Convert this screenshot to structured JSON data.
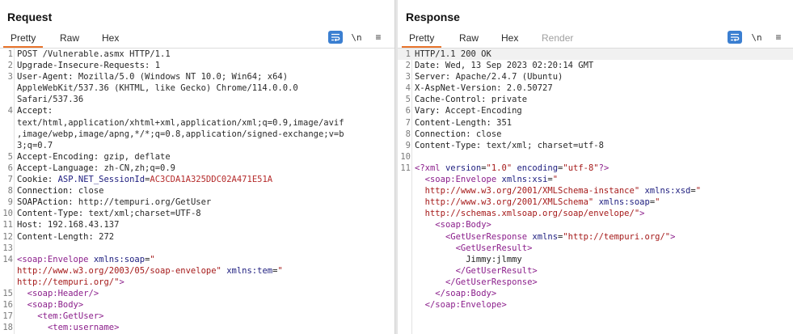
{
  "request": {
    "title": "Request",
    "tabs": [
      "Pretty",
      "Raw",
      "Hex"
    ],
    "active_tab": "Pretty",
    "lines": [
      {
        "n": "1",
        "parts": [
          {
            "c": "hv",
            "t": "POST /Vulnerable.asmx HTTP/1.1"
          }
        ]
      },
      {
        "n": "2",
        "parts": [
          {
            "c": "hn",
            "t": "Upgrade-Insecure-Requests:"
          },
          {
            "c": "hv",
            "t": " 1"
          }
        ]
      },
      {
        "n": "3",
        "parts": [
          {
            "c": "hn",
            "t": "User-Agent:"
          },
          {
            "c": "hv",
            "t": " Mozilla/5.0 (Windows NT 10.0; Win64; x64)"
          }
        ]
      },
      {
        "n": "",
        "parts": [
          {
            "c": "hv",
            "t": "AppleWebKit/537.36 (KHTML, like Gecko) Chrome/114.0.0.0"
          }
        ]
      },
      {
        "n": "",
        "parts": [
          {
            "c": "hv",
            "t": "Safari/537.36"
          }
        ]
      },
      {
        "n": "4",
        "parts": [
          {
            "c": "hn",
            "t": "Accept:"
          }
        ]
      },
      {
        "n": "",
        "parts": [
          {
            "c": "hv",
            "t": "text/html,application/xhtml+xml,application/xml;q=0.9,image/avif"
          }
        ]
      },
      {
        "n": "",
        "parts": [
          {
            "c": "hv",
            "t": ",image/webp,image/apng,*/*;q=0.8,application/signed-exchange;v=b"
          }
        ]
      },
      {
        "n": "",
        "parts": [
          {
            "c": "hv",
            "t": "3;q=0.7"
          }
        ]
      },
      {
        "n": "5",
        "parts": [
          {
            "c": "hn",
            "t": "Accept-Encoding:"
          },
          {
            "c": "hv",
            "t": " gzip, deflate"
          }
        ]
      },
      {
        "n": "6",
        "parts": [
          {
            "c": "hn",
            "t": "Accept-Language:"
          },
          {
            "c": "hv",
            "t": " zh-CN,zh;q=0.9"
          }
        ]
      },
      {
        "n": "7",
        "parts": [
          {
            "c": "hn",
            "t": "Cookie:"
          },
          {
            "c": "hv",
            "t": " "
          },
          {
            "c": "at",
            "t": "ASP.NET_SessionId"
          },
          {
            "c": "hv",
            "t": "="
          },
          {
            "c": "cv",
            "t": "AC3CDA1A325DDC02A471E51A"
          }
        ]
      },
      {
        "n": "8",
        "parts": [
          {
            "c": "hn",
            "t": "Connection:"
          },
          {
            "c": "hv",
            "t": " close"
          }
        ]
      },
      {
        "n": "9",
        "parts": [
          {
            "c": "hn",
            "t": "SOAPAction:"
          },
          {
            "c": "hv",
            "t": " http://tempuri.org/GetUser"
          }
        ]
      },
      {
        "n": "10",
        "parts": [
          {
            "c": "hn",
            "t": "Content-Type:"
          },
          {
            "c": "hv",
            "t": " text/xml;charset=UTF-8"
          }
        ]
      },
      {
        "n": "11",
        "parts": [
          {
            "c": "hn",
            "t": "Host:"
          },
          {
            "c": "hv",
            "t": " 192.168.43.137"
          }
        ]
      },
      {
        "n": "12",
        "parts": [
          {
            "c": "hn",
            "t": "Content-Length:"
          },
          {
            "c": "hv",
            "t": " 272"
          }
        ]
      },
      {
        "n": "13",
        "parts": []
      },
      {
        "n": "14",
        "parts": [
          {
            "c": "tg",
            "t": "<soap:Envelope"
          },
          {
            "c": "tx",
            "t": " "
          },
          {
            "c": "at",
            "t": "xmlns:soap"
          },
          {
            "c": "tx",
            "t": "="
          },
          {
            "c": "sv",
            "t": "\""
          }
        ]
      },
      {
        "n": "",
        "parts": [
          {
            "c": "sv",
            "t": "http://www.w3.org/2003/05/soap-envelope\""
          },
          {
            "c": "tx",
            "t": " "
          },
          {
            "c": "at",
            "t": "xmlns:tem"
          },
          {
            "c": "tx",
            "t": "="
          },
          {
            "c": "sv",
            "t": "\""
          }
        ]
      },
      {
        "n": "",
        "parts": [
          {
            "c": "sv",
            "t": "http://tempuri.org/\""
          },
          {
            "c": "tg",
            "t": ">"
          }
        ]
      },
      {
        "n": "15",
        "parts": [
          {
            "c": "tx",
            "t": "  "
          },
          {
            "c": "tg",
            "t": "<soap:Header/>"
          }
        ]
      },
      {
        "n": "16",
        "parts": [
          {
            "c": "tx",
            "t": "  "
          },
          {
            "c": "tg",
            "t": "<soap:Body>"
          }
        ]
      },
      {
        "n": "17",
        "parts": [
          {
            "c": "tx",
            "t": "    "
          },
          {
            "c": "tg",
            "t": "<tem:GetUser>"
          }
        ]
      },
      {
        "n": "18",
        "parts": [
          {
            "c": "tx",
            "t": "      "
          },
          {
            "c": "tg",
            "t": "<tem:username>"
          }
        ]
      }
    ]
  },
  "response": {
    "title": "Response",
    "tabs": [
      "Pretty",
      "Raw",
      "Hex",
      "Render"
    ],
    "active_tab": "Pretty",
    "lines": [
      {
        "n": "1",
        "hl": true,
        "parts": [
          {
            "c": "hv",
            "t": "HTTP/1.1 200 OK"
          }
        ]
      },
      {
        "n": "2",
        "parts": [
          {
            "c": "hn",
            "t": "Date:"
          },
          {
            "c": "hv",
            "t": " Wed, 13 Sep 2023 02:20:14 GMT"
          }
        ]
      },
      {
        "n": "3",
        "parts": [
          {
            "c": "hn",
            "t": "Server:"
          },
          {
            "c": "hv",
            "t": " Apache/2.4.7 (Ubuntu)"
          }
        ]
      },
      {
        "n": "4",
        "parts": [
          {
            "c": "hn",
            "t": "X-AspNet-Version:"
          },
          {
            "c": "hv",
            "t": " 2.0.50727"
          }
        ]
      },
      {
        "n": "5",
        "parts": [
          {
            "c": "hn",
            "t": "Cache-Control:"
          },
          {
            "c": "hv",
            "t": " private"
          }
        ]
      },
      {
        "n": "6",
        "parts": [
          {
            "c": "hn",
            "t": "Vary:"
          },
          {
            "c": "hv",
            "t": " Accept-Encoding"
          }
        ]
      },
      {
        "n": "7",
        "parts": [
          {
            "c": "hn",
            "t": "Content-Length:"
          },
          {
            "c": "hv",
            "t": " 351"
          }
        ]
      },
      {
        "n": "8",
        "parts": [
          {
            "c": "hn",
            "t": "Connection:"
          },
          {
            "c": "hv",
            "t": " close"
          }
        ]
      },
      {
        "n": "9",
        "parts": [
          {
            "c": "hn",
            "t": "Content-Type:"
          },
          {
            "c": "hv",
            "t": " text/xml; charset=utf-8"
          }
        ]
      },
      {
        "n": "10",
        "parts": []
      },
      {
        "n": "11",
        "parts": [
          {
            "c": "tg",
            "t": "<?xml"
          },
          {
            "c": "tx",
            "t": " "
          },
          {
            "c": "at",
            "t": "version"
          },
          {
            "c": "tx",
            "t": "="
          },
          {
            "c": "sv",
            "t": "\"1.0\""
          },
          {
            "c": "tx",
            "t": " "
          },
          {
            "c": "at",
            "t": "encoding"
          },
          {
            "c": "tx",
            "t": "="
          },
          {
            "c": "sv",
            "t": "\"utf-8\""
          },
          {
            "c": "tg",
            "t": "?>"
          }
        ]
      },
      {
        "n": "",
        "parts": [
          {
            "c": "tx",
            "t": "  "
          },
          {
            "c": "tg",
            "t": "<soap:Envelope"
          },
          {
            "c": "tx",
            "t": " "
          },
          {
            "c": "at",
            "t": "xmlns:xsi"
          },
          {
            "c": "tx",
            "t": "="
          },
          {
            "c": "sv",
            "t": "\""
          }
        ]
      },
      {
        "n": "",
        "parts": [
          {
            "c": "sv",
            "t": "  http://www.w3.org/2001/XMLSchema-instance\""
          },
          {
            "c": "tx",
            "t": " "
          },
          {
            "c": "at",
            "t": "xmlns:xsd"
          },
          {
            "c": "tx",
            "t": "="
          },
          {
            "c": "sv",
            "t": "\""
          }
        ]
      },
      {
        "n": "",
        "parts": [
          {
            "c": "sv",
            "t": "  http://www.w3.org/2001/XMLSchema\""
          },
          {
            "c": "tx",
            "t": " "
          },
          {
            "c": "at",
            "t": "xmlns:soap"
          },
          {
            "c": "tx",
            "t": "="
          },
          {
            "c": "sv",
            "t": "\""
          }
        ]
      },
      {
        "n": "",
        "parts": [
          {
            "c": "sv",
            "t": "  http://schemas.xmlsoap.org/soap/envelope/\""
          },
          {
            "c": "tg",
            "t": ">"
          }
        ]
      },
      {
        "n": "",
        "parts": [
          {
            "c": "tx",
            "t": "    "
          },
          {
            "c": "tg",
            "t": "<soap:Body>"
          }
        ]
      },
      {
        "n": "",
        "parts": [
          {
            "c": "tx",
            "t": "      "
          },
          {
            "c": "tg",
            "t": "<GetUserResponse"
          },
          {
            "c": "tx",
            "t": " "
          },
          {
            "c": "at",
            "t": "xmlns"
          },
          {
            "c": "tx",
            "t": "="
          },
          {
            "c": "sv",
            "t": "\"http://tempuri.org/\""
          },
          {
            "c": "tg",
            "t": ">"
          }
        ]
      },
      {
        "n": "",
        "parts": [
          {
            "c": "tx",
            "t": "        "
          },
          {
            "c": "tg",
            "t": "<GetUserResult>"
          }
        ]
      },
      {
        "n": "",
        "parts": [
          {
            "c": "tx",
            "t": "          Jimmy:jlmmy"
          }
        ]
      },
      {
        "n": "",
        "parts": [
          {
            "c": "tx",
            "t": "        "
          },
          {
            "c": "tg",
            "t": "</GetUserResult>"
          }
        ]
      },
      {
        "n": "",
        "parts": [
          {
            "c": "tx",
            "t": "      "
          },
          {
            "c": "tg",
            "t": "</GetUserResponse>"
          }
        ]
      },
      {
        "n": "",
        "parts": [
          {
            "c": "tx",
            "t": "    "
          },
          {
            "c": "tg",
            "t": "</soap:Body>"
          }
        ]
      },
      {
        "n": "",
        "parts": [
          {
            "c": "tx",
            "t": "  "
          },
          {
            "c": "tg",
            "t": "</soap:Envelope>"
          }
        ]
      }
    ]
  },
  "toolbar": {
    "newline_label": "\\n",
    "menu_glyph": "≡"
  },
  "colors": {
    "accent": "#e8742c",
    "toggle_blue": "#3b7fd1",
    "tag": "#8b1e8b",
    "string": "#a51a1a"
  }
}
